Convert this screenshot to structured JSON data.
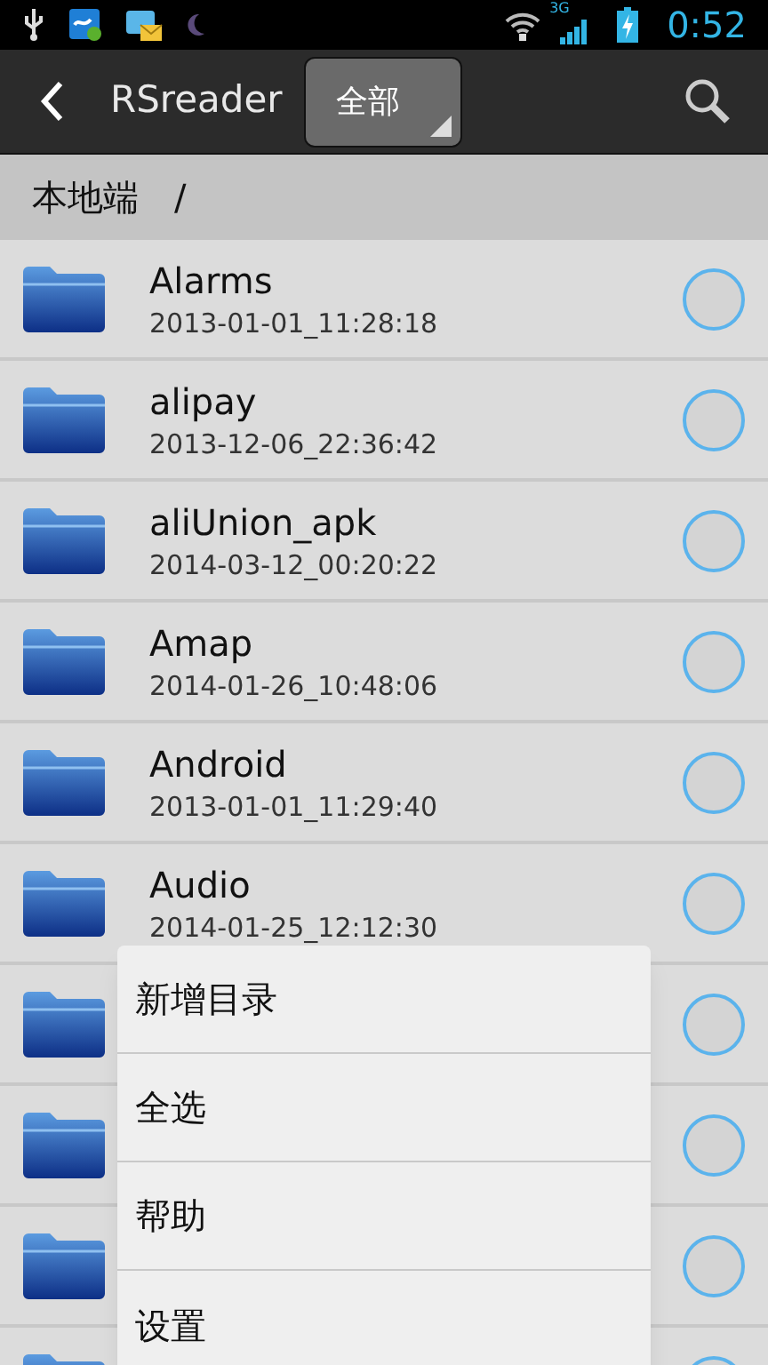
{
  "status_bar": {
    "network": "3G",
    "time": "0:52"
  },
  "action_bar": {
    "title": "RSreader",
    "filter": "全部"
  },
  "path_bar": {
    "location": "本地端",
    "separator": "/"
  },
  "rows": [
    {
      "kind": "folder",
      "name": "Alarms",
      "date": "2013-01-01_11:28:18",
      "selected": false
    },
    {
      "kind": "folder",
      "name": "alipay",
      "date": "2013-12-06_22:36:42",
      "selected": false
    },
    {
      "kind": "folder",
      "name": "aliUnion_apk",
      "date": "2014-03-12_00:20:22",
      "selected": false
    },
    {
      "kind": "folder",
      "name": "Amap",
      "date": "2014-01-26_10:48:06",
      "selected": false
    },
    {
      "kind": "folder",
      "name": "Android",
      "date": "2013-01-01_11:29:40",
      "selected": false
    },
    {
      "kind": "folder",
      "name": "Audio",
      "date": "2014-01-25_12:12:30",
      "selected": false
    },
    {
      "kind": "folder",
      "selected": false
    },
    {
      "kind": "folder",
      "selected": false
    },
    {
      "kind": "folder",
      "selected": false
    },
    {
      "kind": "folder",
      "selected": false
    }
  ],
  "menu": {
    "items": [
      "新增目录",
      "全选",
      "帮助",
      "设置"
    ]
  }
}
